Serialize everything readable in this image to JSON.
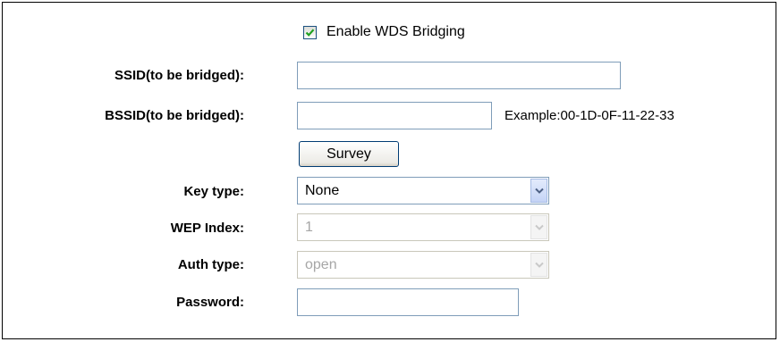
{
  "wds": {
    "enable_label": "Enable WDS Bridging",
    "enabled": true
  },
  "form": {
    "ssid": {
      "label": "SSID(to be bridged):",
      "value": ""
    },
    "bssid": {
      "label": "BSSID(to be bridged):",
      "value": "",
      "example": "Example:00-1D-0F-11-22-33"
    },
    "survey_label": "Survey",
    "key_type": {
      "label": "Key type:",
      "value": "None"
    },
    "wep_index": {
      "label": "WEP Index:",
      "value": "1"
    },
    "auth_type": {
      "label": "Auth type:",
      "value": "open"
    },
    "password": {
      "label": "Password:",
      "value": ""
    }
  },
  "colors": {
    "checkmark": "#21a121",
    "input_border": "#7f9db9",
    "disabled_text": "#a6a6a6"
  },
  "icons": {
    "checkbox": "check-icon",
    "dropdown": "chevron-down-icon"
  }
}
